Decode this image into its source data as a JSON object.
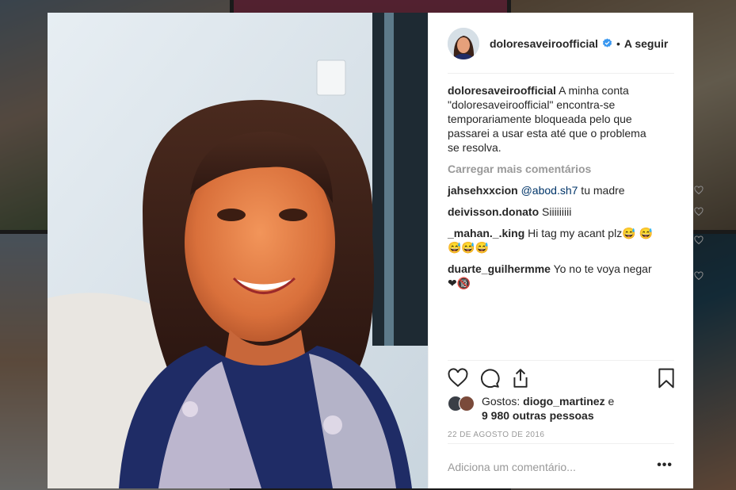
{
  "post": {
    "username": "doloresaveiroofficial",
    "verified": true,
    "separator": "•",
    "follow_label": "A seguir",
    "caption_user": "doloresaveiroofficial",
    "caption_text": "A minha conta \"doloresaveiroofficial\" encontra-se temporariamente bloqueada pelo que passarei a usar esta até que o problema se resolva.",
    "load_more": "Carregar mais comentários",
    "comments": [
      {
        "user": "jahsehxxcion",
        "mention": "@abod.sh7",
        "text": " tu madre"
      },
      {
        "user": "deivisson.donato",
        "text": "Siiiiiiiii"
      },
      {
        "user": "_mahan._.king",
        "text": "Hi tag my acant plz😅 😅😅😅😅"
      },
      {
        "user": "duarte_guilhermme",
        "text": "Yo no te voya negar❤🔞"
      }
    ],
    "likes_prefix": "Gostos:",
    "likes_user": "diogo_martinez",
    "likes_and": "e",
    "likes_count": "9 980 outras pessoas",
    "date": "22 DE AGOSTO DE 2016",
    "add_comment_placeholder": "Adiciona um comentário...",
    "more_label": "•••"
  },
  "icons": {
    "verified": "verified-badge-icon",
    "like": "heart-icon",
    "comment": "comment-icon",
    "share": "share-icon",
    "save": "bookmark-icon"
  },
  "colors": {
    "text": "#262626",
    "muted": "#999999",
    "link": "#003569",
    "verified": "#3897f0",
    "divider": "#efefef"
  }
}
